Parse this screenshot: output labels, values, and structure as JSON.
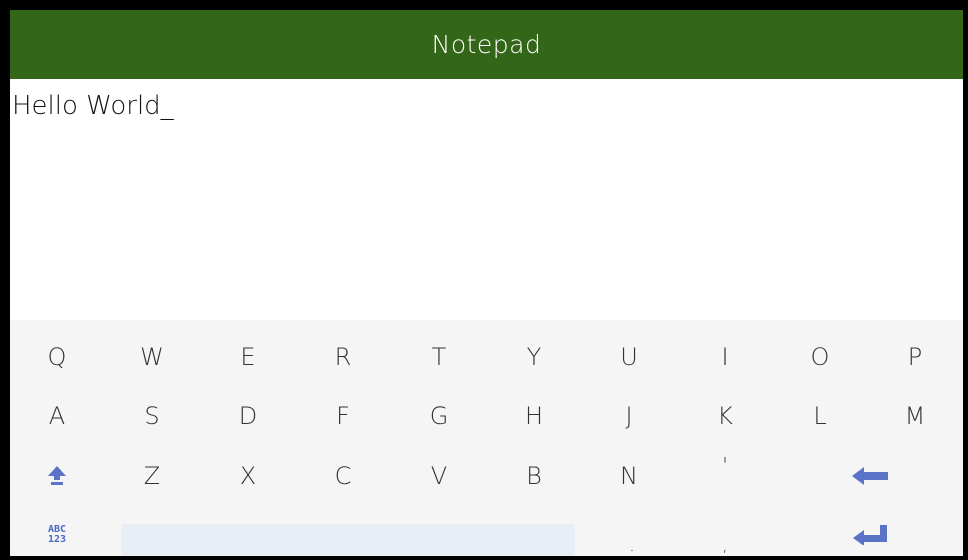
{
  "app": {
    "title": "Notepad"
  },
  "editor": {
    "content": "Hello World_"
  },
  "keyboard": {
    "row1": [
      "Q",
      "W",
      "E",
      "R",
      "T",
      "Y",
      "U",
      "I",
      "O",
      "P"
    ],
    "row2": [
      "A",
      "S",
      "D",
      "F",
      "G",
      "H",
      "J",
      "K",
      "L",
      "M"
    ],
    "row3": [
      "Z",
      "X",
      "C",
      "V",
      "B",
      "N",
      "'"
    ],
    "row4": [
      ".",
      ","
    ],
    "mode_key": {
      "line1": "ABC",
      "line2": "123"
    },
    "icons": {
      "shift": "shift-up-icon",
      "backspace": "backspace-arrow-icon",
      "enter": "enter-return-icon"
    },
    "accent_color": "#5b73c6"
  },
  "colors": {
    "titlebar": "#336618",
    "keyboard_bg": "#f5f5f5",
    "space_bar": "#e8eef5"
  }
}
